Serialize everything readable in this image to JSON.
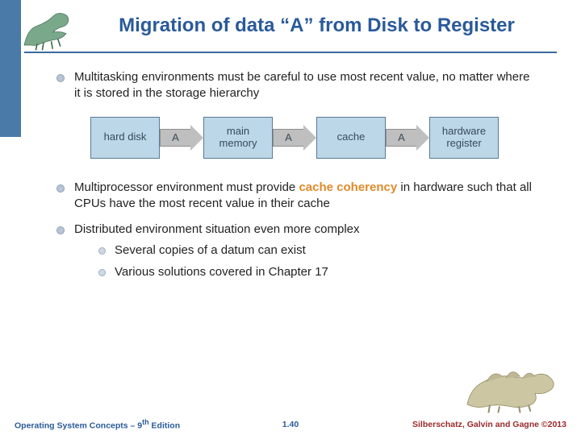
{
  "header": {
    "title": "Migration of data “A” from Disk to Register"
  },
  "bullets": {
    "b1": "Multitasking environments must be careful to use most recent value, no matter where it is stored in the storage hierarchy",
    "b2_pre": "Multiprocessor environment must provide ",
    "b2_hl": "cache coherency",
    "b2_post": " in hardware such that all CPUs have the most recent value in their cache",
    "b3": "Distributed environment situation even more complex",
    "b3_sub1": "Several copies of a datum can exist",
    "b3_sub2": "Various solutions covered in Chapter 17"
  },
  "diagram": {
    "box1": "hard disk",
    "box2": "main memory",
    "box3": "cache",
    "box4": "hardware register",
    "arrow_label": "A"
  },
  "footer": {
    "left_text": "Operating System Concepts – 9",
    "left_ed": "th",
    "left_suffix": " Edition",
    "center": "1.40",
    "right": "Silberschatz, Galvin and Gagne ©2013"
  },
  "icons": {
    "dino_tl": "dinosaur-icon",
    "dino_br": "dinosaur-icon"
  }
}
